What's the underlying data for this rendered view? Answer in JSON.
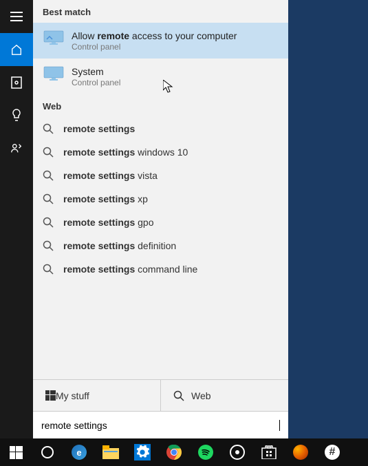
{
  "section_best_match": "Best match",
  "section_web": "Web",
  "results": [
    {
      "title_pre": "Allow ",
      "title_bold": "remote",
      "title_post": " access to your computer",
      "sub": "Control panel"
    },
    {
      "title_pre": "",
      "title_bold": "",
      "title_post": "System",
      "sub": "Control panel"
    }
  ],
  "web_suggestions": [
    {
      "bold": "remote settings",
      "rest": ""
    },
    {
      "bold": "remote settings",
      "rest": " windows 10"
    },
    {
      "bold": "remote settings",
      "rest": " vista"
    },
    {
      "bold": "remote settings",
      "rest": " xp"
    },
    {
      "bold": "remote settings",
      "rest": " gpo"
    },
    {
      "bold": "remote settings",
      "rest": " definition"
    },
    {
      "bold": "remote settings",
      "rest": " command line"
    }
  ],
  "filters": {
    "my_stuff": "My stuff",
    "web": "Web"
  },
  "search_value": "remote settings",
  "taskbar_apps": [
    "start",
    "cortana",
    "edge",
    "explorer",
    "settings",
    "chrome",
    "spotify",
    "app1",
    "store",
    "firefox",
    "slack"
  ]
}
